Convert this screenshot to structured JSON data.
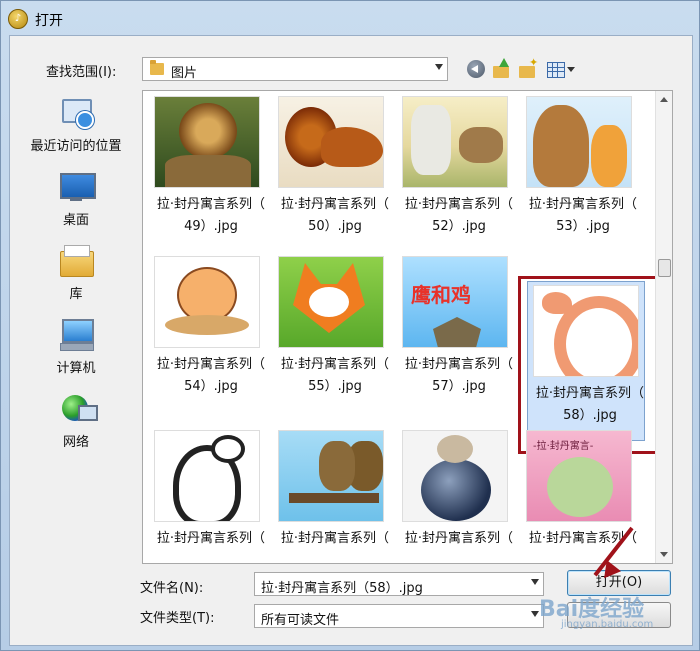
{
  "window": {
    "title": "打开"
  },
  "toolbar": {
    "lookin_label": "查找范围(I):",
    "lookin_value": "图片"
  },
  "places": [
    {
      "label": "最近访问的位置",
      "icon": "recent-places-icon"
    },
    {
      "label": "桌面",
      "icon": "desktop-icon"
    },
    {
      "label": "库",
      "icon": "library-icon"
    },
    {
      "label": "计算机",
      "icon": "computer-icon"
    },
    {
      "label": "网络",
      "icon": "network-icon"
    }
  ],
  "files": [
    {
      "line1": "拉·封丹寓言系列（",
      "line2": "49）.jpg"
    },
    {
      "line1": "拉·封丹寓言系列（",
      "line2": "50）.jpg"
    },
    {
      "line1": "拉·封丹寓言系列（",
      "line2": "52）.jpg"
    },
    {
      "line1": "拉·封丹寓言系列（",
      "line2": "53）.jpg"
    },
    {
      "line1": "拉·封丹寓言系列（",
      "line2": "54）.jpg"
    },
    {
      "line1": "拉·封丹寓言系列（",
      "line2": "55）.jpg"
    },
    {
      "line1": "拉·封丹寓言系列（",
      "line2": "57）.jpg"
    },
    {
      "line1": "拉·封丹寓言系列（",
      "line2": "58）.jpg",
      "selected": true
    },
    {
      "line1": "拉·封丹寓言系列（",
      "line2": ""
    },
    {
      "line1": "拉·封丹寓言系列（",
      "line2": ""
    },
    {
      "line1": "拉·封丹寓言系列（",
      "line2": ""
    },
    {
      "line1": "拉·封丹寓言系列（",
      "line2": ""
    }
  ],
  "filename": {
    "label": "文件名(N):",
    "value": "拉·封丹寓言系列（58）.jpg"
  },
  "filetype": {
    "label": "文件类型(T):",
    "value": "所有可读文件"
  },
  "buttons": {
    "open": "打开(O)",
    "cancel": ""
  },
  "watermark": {
    "text": "Bai度经验",
    "sub": "jingyan.baidu.com"
  },
  "colors": {
    "annotation": "#a0121a",
    "selection": "#cfe3fb"
  }
}
